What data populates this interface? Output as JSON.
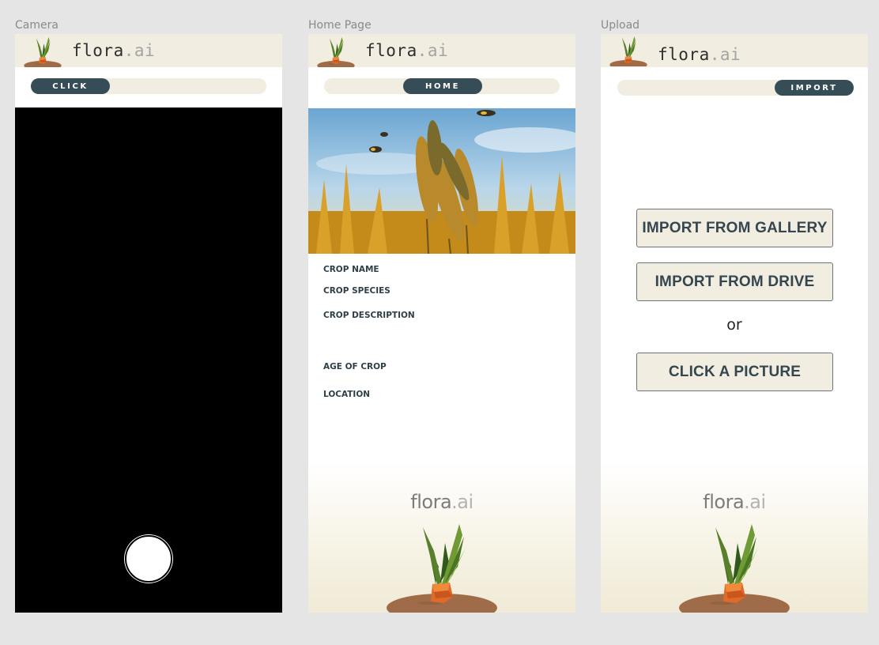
{
  "frames": {
    "camera": {
      "label": "Camera",
      "nav_label": "CLICK"
    },
    "home": {
      "label": "Home Page",
      "nav_label": "HOME",
      "fields": {
        "crop_name": "CROP NAME",
        "crop_species": "CROP SPECIES",
        "crop_description": "CROP DESCRIPTION",
        "age_of_crop": "AGE OF CROP",
        "location": "LOCATION"
      }
    },
    "upload": {
      "label": "Upload",
      "nav_label": "IMPORT",
      "buttons": {
        "gallery": "IMPORT FROM GALLERY",
        "drive": "IMPORT FROM DRIVE",
        "or": "or",
        "camera": "CLICK A PICTURE"
      }
    }
  },
  "brand": {
    "name": "flora",
    "suffix": ".ai"
  },
  "colors": {
    "canvas": "#e5e5e5",
    "header_bg": "#f1ede0",
    "accent_dark": "#364d58",
    "button_bg": "#f1ede0"
  },
  "icons": {
    "header_logo": "carrot-logo-icon",
    "shutter": "shutter-icon",
    "footer_logo": "carrot-illustration"
  }
}
